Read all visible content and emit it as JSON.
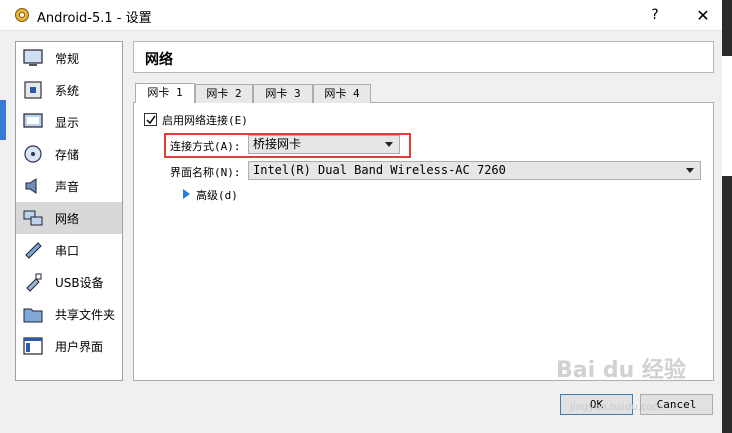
{
  "window": {
    "title": "Android-5.1 - 设置",
    "help_label": "?",
    "close_label": "✕"
  },
  "sidebar": {
    "items": [
      {
        "label": "常规",
        "icon": "general-icon"
      },
      {
        "label": "系统",
        "icon": "system-icon"
      },
      {
        "label": "显示",
        "icon": "display-icon"
      },
      {
        "label": "存储",
        "icon": "storage-icon"
      },
      {
        "label": "声音",
        "icon": "audio-icon"
      },
      {
        "label": "网络",
        "icon": "network-icon",
        "active": true
      },
      {
        "label": "串口",
        "icon": "serial-port-icon"
      },
      {
        "label": "USB设备",
        "icon": "usb-icon"
      },
      {
        "label": "共享文件夹",
        "icon": "shared-folder-icon"
      },
      {
        "label": "用户界面",
        "icon": "user-interface-icon"
      }
    ]
  },
  "header": {
    "title": "网络"
  },
  "tabs": [
    {
      "label": "网卡 1",
      "active": true
    },
    {
      "label": "网卡 2"
    },
    {
      "label": "网卡 3"
    },
    {
      "label": "网卡 4"
    }
  ],
  "adapter": {
    "enable_label": "启用网络连接(E)",
    "enabled": true,
    "attach_label": "连接方式(A):",
    "attach_value": "桥接网卡",
    "interface_label": "界面名称(N):",
    "interface_value": "Intel(R) Dual Band Wireless-AC 7260",
    "advanced_label": "高级(d)"
  },
  "buttons": {
    "ok": "OK",
    "cancel": "Cancel"
  },
  "watermark": {
    "text": "Bai du 经验",
    "url": "jingyan.baidu.com"
  },
  "colors": {
    "highlight": "#e03c3c",
    "accent": "#2a7ed8",
    "active_item_bg": "#d8d8d8"
  }
}
